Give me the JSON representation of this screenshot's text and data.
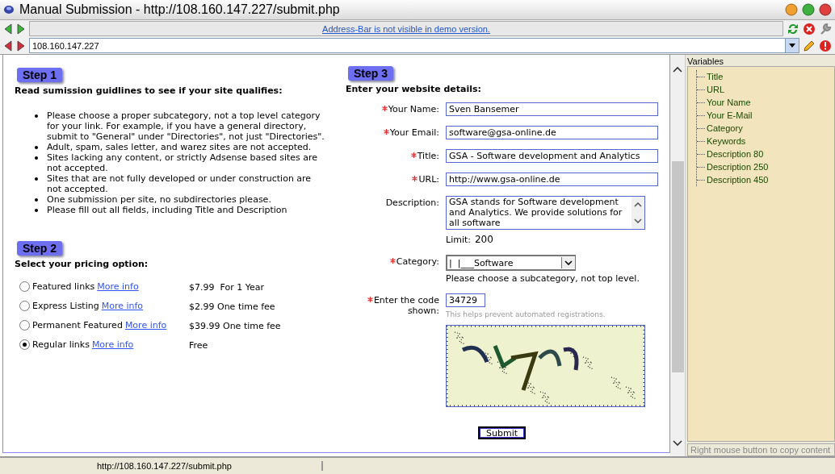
{
  "window": {
    "title": "Manual Submission - http://108.160.147.227/submit.php"
  },
  "notice": "Address-Bar is not visible in demo version.",
  "address": {
    "value": "108.160.147.227"
  },
  "step1": {
    "badge": "Step 1",
    "heading": "Read sumission guidlines to see if your site qualifies:",
    "rules": [
      "Please choose a proper subcategory, not a top level category for your link. For example, if you have a general directory, submit to \"General\" under \"Directories\", not just \"Directories\".",
      "Adult, spam, sales letter, and warez sites are not accepted.",
      "Sites lacking any content, or strictly Adsense based sites are not accepted.",
      "Sites that are not fully developed or under construction are not accepted.",
      "One submission per site, no subdirectories please.",
      "Please fill out all fields, including Title and Description"
    ]
  },
  "step2": {
    "badge": "Step 2",
    "heading": "Select your pricing option:",
    "options": [
      {
        "label": "Featured links",
        "link": "More info",
        "price": "$7.99  For 1 Year",
        "selected": false
      },
      {
        "label": "Express Listing",
        "link": "More info",
        "price": "$2.99 One time fee",
        "selected": false
      },
      {
        "label": "Permanent Featured",
        "link": "More info",
        "price": "$39.99 One time fee",
        "selected": false
      },
      {
        "label": "Regular links",
        "link": "More info",
        "price": "Free",
        "selected": true
      }
    ]
  },
  "step3": {
    "badge": "Step 3",
    "heading": "Enter your website details:",
    "fields": [
      {
        "kind": "text",
        "label": "Your Name:",
        "required": true,
        "value": "Sven Bansemer"
      },
      {
        "kind": "text",
        "label": "Your Email:",
        "required": true,
        "value": "software@gsa-online.de"
      },
      {
        "kind": "text",
        "label": "Title:",
        "required": true,
        "value": "GSA - Software development and Analytics"
      },
      {
        "kind": "text",
        "label": "URL:",
        "required": true,
        "value": "http://www.gsa-online.de"
      },
      {
        "kind": "textarea",
        "label": "Description:",
        "required": false,
        "value": "GSA stands for Software development and Analytics. We provide solutions for all software",
        "note": "Limit:",
        "limit": "200"
      },
      {
        "kind": "select",
        "label": "Category:",
        "required": true,
        "value": "|  |___Software",
        "hint": "Please choose a subcategory, not top level."
      },
      {
        "kind": "code",
        "label": "Enter the code shown:",
        "required": true,
        "value": "34729",
        "hint": "This helps prevent automated registrations."
      }
    ],
    "submit": "Submit"
  },
  "variables": {
    "title": "Variables",
    "items": [
      "Title",
      "URL",
      "Your Name",
      "Your E-Mail",
      "Category",
      "Keywords",
      "Description 80",
      "Description 250",
      "Description 450"
    ],
    "footer": "Right mouse button to copy content"
  },
  "status_bar": {
    "url": "http://108.160.147.227/submit.php"
  }
}
